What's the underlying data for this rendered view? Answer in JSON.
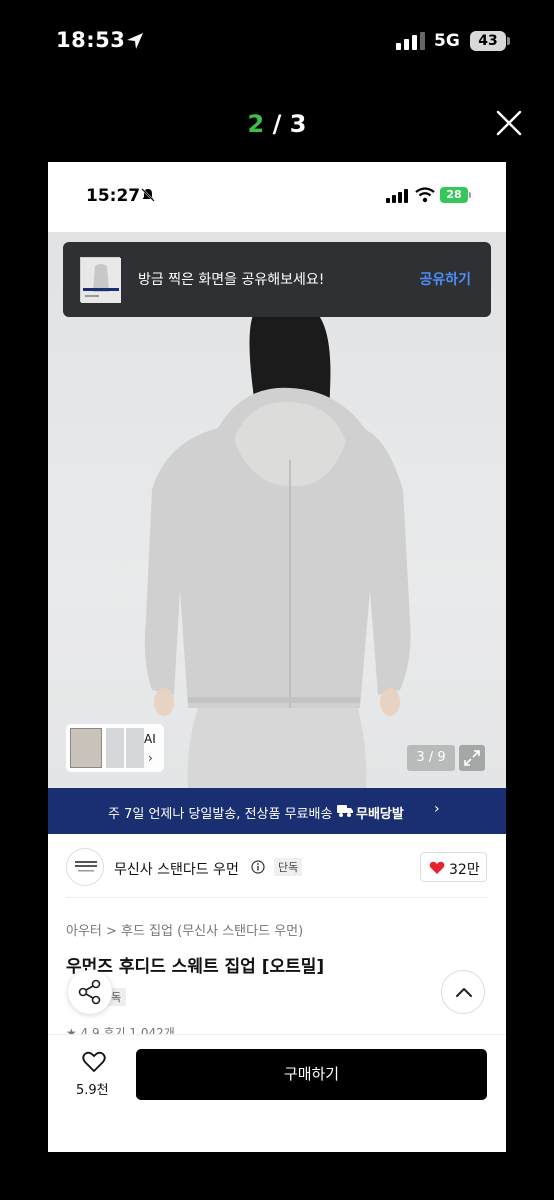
{
  "outer_status": {
    "time": "18:53",
    "network": "5G",
    "battery": "43"
  },
  "viewer": {
    "current": "2",
    "separator": " / ",
    "total": "3"
  },
  "inner_status": {
    "time": "15:27",
    "battery": "28"
  },
  "toast": {
    "message": "방금 찍은 화면을 공유해보세요!",
    "action": "공유하기"
  },
  "gallery": {
    "ai_label": "AI",
    "ai_arrow": "›",
    "page_indicator": "3 / 9"
  },
  "banner": {
    "text": "주 7일 언제나 당일발송, 전상품 무료배송",
    "badge": "무배당발",
    "arrow": "›"
  },
  "brand": {
    "name": "무신사 스탠다드 우먼",
    "tag": "단독",
    "likes": "32만"
  },
  "product": {
    "breadcrumb": "아우터 > 후드 집업 (무신사 스탠다드 우먼)",
    "title": "우먼즈 후디드 스웨트 집업 [오트밀]",
    "exclusive_tag": "단독",
    "review_partial": "★ 4.9  후기 1,042개"
  },
  "bottom": {
    "wish_count": "5.9천",
    "buy_label": "구매하기"
  },
  "colors": {
    "accent_green": "#3fbf4a",
    "banner_navy": "#1a2e72",
    "link_blue": "#4b8ff7",
    "heart_red": "#e8232f"
  }
}
